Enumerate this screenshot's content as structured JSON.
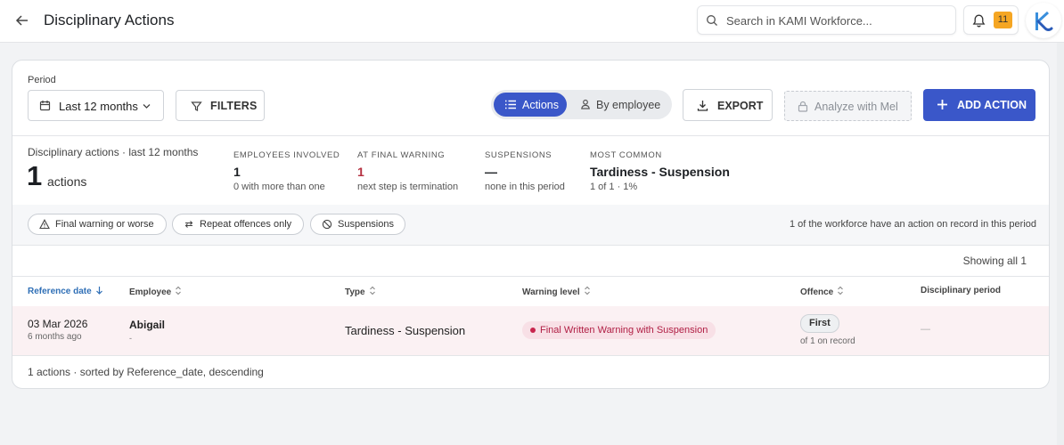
{
  "header": {
    "title": "Disciplinary Actions",
    "search_placeholder": "Search in KAMI Workforce...",
    "notification_count": "11"
  },
  "toolbar": {
    "period_label": "Period",
    "period_value": "Last 12 months",
    "filters_label": "FILTERS",
    "view_actions_label": "Actions",
    "view_employee_label": "By employee",
    "export_label": "EXPORT",
    "analyze_label": "Analyze with Mel",
    "add_action_label": "ADD ACTION"
  },
  "stats": {
    "caption": "Disciplinary actions · last 12 months",
    "total": "1",
    "total_unit": "actions",
    "items": [
      {
        "label": "EMPLOYEES INVOLVED",
        "value": "1",
        "sub": "0 with more than one"
      },
      {
        "label": "AT FINAL WARNING",
        "value": "1",
        "sub": "next step is termination"
      },
      {
        "label": "SUSPENSIONS",
        "value": "—",
        "sub": "none in this period"
      },
      {
        "label": "MOST COMMON",
        "value": "Tardiness - Suspension",
        "sub": "1 of 1 · 1%"
      }
    ]
  },
  "quick_filters": {
    "chips": [
      "Final warning or worse",
      "Repeat offences only",
      "Suspensions"
    ],
    "note": "1 of the workforce have an action on record in this period"
  },
  "table": {
    "showing": "Showing all 1",
    "columns": [
      "Reference date",
      "Employee",
      "Type",
      "Warning level",
      "Offence",
      "Disciplinary period"
    ],
    "rows": [
      {
        "date": "03 Mar 2026",
        "ago": "6 months ago",
        "employee": "Abigail",
        "employee_sub": "-",
        "type": "Tardiness - Suspension",
        "warning_level": "Final Written Warning with Suspension",
        "offence": "First",
        "offence_sub": "of 1 on record",
        "period": "—"
      }
    ],
    "footer": "1 actions · sorted by Reference_date, descending"
  },
  "colors": {
    "primary": "#3a57c9",
    "danger": "#b01e44",
    "badge": "#f5a623"
  }
}
